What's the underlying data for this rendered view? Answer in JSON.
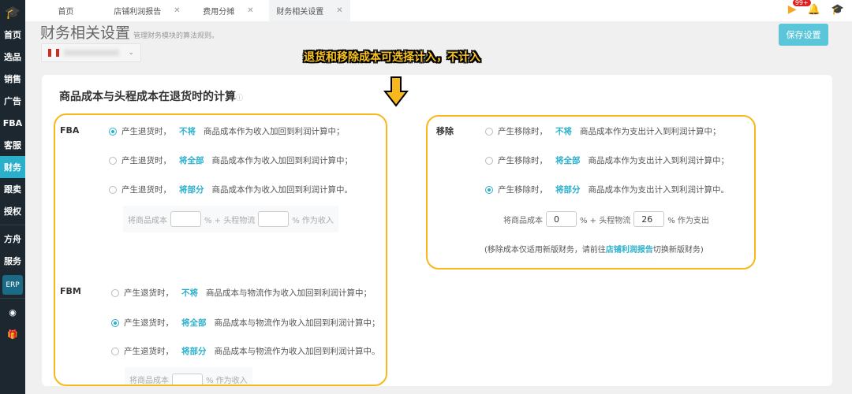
{
  "sidebar": {
    "items": [
      "首页",
      "选品",
      "销售",
      "广告",
      "FBA",
      "客服",
      "财务",
      "跟卖",
      "授权",
      "方舟",
      "服务"
    ],
    "erp": "ERP",
    "active": "财务"
  },
  "tabs": [
    {
      "label": "首页"
    },
    {
      "label": "店铺利润报告"
    },
    {
      "label": "费用分摊"
    },
    {
      "label": "财务相关设置"
    }
  ],
  "header": {
    "badge": "99+",
    "title": "财务相关设置",
    "subtitle": "管理财务模块的算法规则。",
    "save": "保存设置"
  },
  "annotation": "退货和移除成本可选择计入，不计入",
  "section": {
    "title": "商品成本与头程成本在退货时的计算"
  },
  "fba": {
    "label": "FBA",
    "options": [
      {
        "pre": "产生退货时，",
        "hl": "不将",
        "post": "商品成本作为收入加回到利润计算中；",
        "checked": true
      },
      {
        "pre": "产生退货时，",
        "hl": "将全部",
        "post": "商品成本作为收入加回到利润计算中；",
        "checked": false
      },
      {
        "pre": "产生退货时，",
        "hl": "将部分",
        "post": "商品成本作为收入加回到利润计算中。",
        "checked": false
      }
    ],
    "partial": {
      "a": "将商品成本",
      "b": "% + 头程物流",
      "c": "% 作为收入",
      "cost": "",
      "freight": ""
    }
  },
  "fbm": {
    "label": "FBM",
    "options": [
      {
        "pre": "产生退货时，",
        "hl": "不将",
        "post": "商品成本与物流作为收入加回到利润计算中；",
        "checked": false
      },
      {
        "pre": "产生退货时，",
        "hl": "将全部",
        "post": "商品成本与物流作为收入加回到利润计算中；",
        "checked": true
      },
      {
        "pre": "产生退货时，",
        "hl": "将部分",
        "post": "商品成本与物流作为收入加回到利润计算中。",
        "checked": false
      }
    ],
    "partial": {
      "a": "将商品成本",
      "c": "% 作为收入",
      "cost": ""
    }
  },
  "removal": {
    "label": "移除",
    "options": [
      {
        "pre": "产生移除时，",
        "hl": "不将",
        "post": "商品成本作为支出计入到利润计算中；",
        "checked": false
      },
      {
        "pre": "产生移除时，",
        "hl": "将全部",
        "post": "商品成本作为支出计入到利润计算中；",
        "checked": false
      },
      {
        "pre": "产生移除时，",
        "hl": "将部分",
        "post": "商品成本作为支出计入到利润计算中。",
        "checked": true
      }
    ],
    "partial": {
      "a": "将商品成本",
      "b": "% + 头程物流",
      "c": "% 作为支出",
      "cost": "0",
      "freight": "26"
    },
    "note_pre": "(移除成本仅适用新版财务，请前往",
    "note_link": "店铺利润报告",
    "note_post": "切换新版财务)"
  },
  "colors": {
    "accent": "#2bb0cc",
    "highlight": "#f8b81c",
    "sidebar": "#1c2730"
  }
}
